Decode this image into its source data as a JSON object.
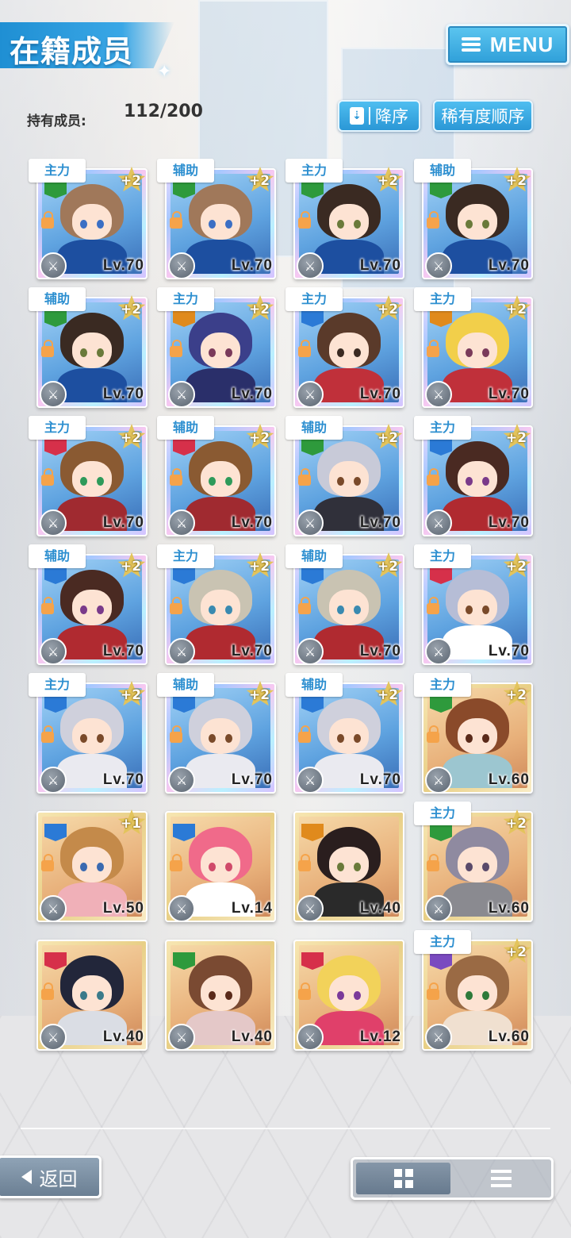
{
  "header": {
    "title": "在籍成员",
    "menu_label": "MENU"
  },
  "stats": {
    "owned_label": "持有成员:",
    "owned_value": "112/200"
  },
  "sort": {
    "order_label": "降序",
    "rarity_label": "稀有度顺序"
  },
  "cards": [
    {
      "role": "主力",
      "plus": "+2",
      "level": "Lv.70",
      "rarity": "rainbow",
      "attr_color": "#2e9a3c",
      "hair": "#a0785a",
      "eye": "#3b6fc4",
      "outfit": "#1d4fa0",
      "lock": true
    },
    {
      "role": "辅助",
      "plus": "+2",
      "level": "Lv.70",
      "rarity": "rainbow",
      "attr_color": "#2e9a3c",
      "hair": "#a0785a",
      "eye": "#3b6fc4",
      "outfit": "#1d4fa0",
      "lock": true
    },
    {
      "role": "主力",
      "plus": "+2",
      "level": "Lv.70",
      "rarity": "rainbow",
      "attr_color": "#2e9a3c",
      "hair": "#3a2a22",
      "eye": "#6a7a3a",
      "outfit": "#1d4fa0",
      "lock": true
    },
    {
      "role": "辅助",
      "plus": "+2",
      "level": "Lv.70",
      "rarity": "rainbow",
      "attr_color": "#2e9a3c",
      "hair": "#3a2a22",
      "eye": "#6a7a3a",
      "outfit": "#1d4fa0",
      "lock": true
    },
    {
      "role": "辅助",
      "plus": "+2",
      "level": "Lv.70",
      "rarity": "rainbow",
      "attr_color": "#2e9a3c",
      "hair": "#3a2a22",
      "eye": "#6a7a3a",
      "outfit": "#1d4fa0",
      "lock": true
    },
    {
      "role": "主力",
      "plus": "+2",
      "level": "Lv.70",
      "rarity": "rainbow",
      "attr_color": "#e08a1c",
      "hair": "#3b3f8a",
      "eye": "#7a3a5a",
      "outfit": "#2a2f6a",
      "lock": true
    },
    {
      "role": "主力",
      "plus": "+2",
      "level": "Lv.70",
      "rarity": "rainbow",
      "attr_color": "#2b7ad6",
      "hair": "#5a3a2a",
      "eye": "#3a2a22",
      "outfit": "#c0303a",
      "lock": true
    },
    {
      "role": "主力",
      "plus": "+2",
      "level": "Lv.70",
      "rarity": "rainbow",
      "attr_color": "#e08a1c",
      "hair": "#f2cf4a",
      "eye": "#7a3a5a",
      "outfit": "#c0303a",
      "lock": true
    },
    {
      "role": "主力",
      "plus": "+2",
      "level": "Lv.70",
      "rarity": "rainbow",
      "attr_color": "#d6304a",
      "hair": "#8a5a32",
      "eye": "#2e9a5a",
      "outfit": "#a02a30",
      "lock": true
    },
    {
      "role": "辅助",
      "plus": "+2",
      "level": "Lv.70",
      "rarity": "rainbow",
      "attr_color": "#d6304a",
      "hair": "#8a5a32",
      "eye": "#2e9a5a",
      "outfit": "#a02a30",
      "lock": true
    },
    {
      "role": "辅助",
      "plus": "+2",
      "level": "Lv.70",
      "rarity": "rainbow",
      "attr_color": "#2e9a3c",
      "hair": "#c8cad8",
      "eye": "#7a4a2a",
      "outfit": "#30303a",
      "lock": true
    },
    {
      "role": "主力",
      "plus": "+2",
      "level": "Lv.70",
      "rarity": "rainbow",
      "attr_color": "#2b7ad6",
      "hair": "#4a2a22",
      "eye": "#7a3a8a",
      "outfit": "#b02a30",
      "lock": true
    },
    {
      "role": "辅助",
      "plus": "+2",
      "level": "Lv.70",
      "rarity": "rainbow",
      "attr_color": "#2b7ad6",
      "hair": "#4a2a22",
      "eye": "#7a3a8a",
      "outfit": "#b02a30",
      "lock": true
    },
    {
      "role": "主力",
      "plus": "+2",
      "level": "Lv.70",
      "rarity": "rainbow",
      "attr_color": "#2b7ad6",
      "hair": "#c9c3b2",
      "eye": "#3a8ab0",
      "outfit": "#b02a30",
      "lock": true
    },
    {
      "role": "辅助",
      "plus": "+2",
      "level": "Lv.70",
      "rarity": "rainbow",
      "attr_color": "#2b7ad6",
      "hair": "#c9c3b2",
      "eye": "#3a8ab0",
      "outfit": "#b02a30",
      "lock": true
    },
    {
      "role": "主力",
      "plus": "+2",
      "level": "Lv.70",
      "rarity": "rainbow",
      "attr_color": "#d6304a",
      "hair": "#b6bdd6",
      "eye": "#7a4a2a",
      "outfit": "#ffffff",
      "lock": true
    },
    {
      "role": "主力",
      "plus": "+2",
      "level": "Lv.70",
      "rarity": "rainbow",
      "attr_color": "#2b7ad6",
      "hair": "#cfd0dc",
      "eye": "#7a4a2a",
      "outfit": "#eaeaf0",
      "lock": true
    },
    {
      "role": "辅助",
      "plus": "+2",
      "level": "Lv.70",
      "rarity": "rainbow",
      "attr_color": "#2b7ad6",
      "hair": "#cfd0dc",
      "eye": "#7a4a2a",
      "outfit": "#eaeaf0",
      "lock": true
    },
    {
      "role": "辅助",
      "plus": "+2",
      "level": "Lv.70",
      "rarity": "rainbow",
      "attr_color": "#2b7ad6",
      "hair": "#cfd0dc",
      "eye": "#7a4a2a",
      "outfit": "#eaeaf0",
      "lock": true
    },
    {
      "role": "主力",
      "plus": "+2",
      "level": "Lv.60",
      "rarity": "gold",
      "attr_color": "#2e9a3c",
      "hair": "#8a4a2a",
      "eye": "#5a2a1a",
      "outfit": "#9cc6d0",
      "lock": true
    },
    {
      "role": "",
      "plus": "+1",
      "level": "Lv.50",
      "rarity": "gold",
      "attr_color": "#2b7ad6",
      "hair": "#c48a4a",
      "eye": "#3a6ab0",
      "outfit": "#f0b0b8",
      "lock": true
    },
    {
      "role": "",
      "plus": "",
      "level": "Lv.14",
      "rarity": "gold",
      "attr_color": "#2b7ad6",
      "hair": "#f06a8a",
      "eye": "#d04a6a",
      "outfit": "#ffffff",
      "lock": true
    },
    {
      "role": "",
      "plus": "",
      "level": "Lv.40",
      "rarity": "gold",
      "attr_color": "#e08a1c",
      "hair": "#2a1e1e",
      "eye": "#6a7a3a",
      "outfit": "#2a2a2a",
      "lock": true
    },
    {
      "role": "主力",
      "plus": "+2",
      "level": "Lv.60",
      "rarity": "gold",
      "attr_color": "#2e9a3c",
      "hair": "#8f8aa0",
      "eye": "#5a4a6a",
      "outfit": "#8a8a90",
      "lock": true
    },
    {
      "role": "",
      "plus": "",
      "level": "Lv.40",
      "rarity": "gold",
      "attr_color": "#d6304a",
      "hair": "#22263a",
      "eye": "#3a7a8a",
      "outfit": "#dadde4",
      "lock": true
    },
    {
      "role": "",
      "plus": "",
      "level": "Lv.40",
      "rarity": "gold",
      "attr_color": "#2e9a3c",
      "hair": "#7a4a32",
      "eye": "#5a2a1a",
      "outfit": "#e4c8c8",
      "lock": false
    },
    {
      "role": "",
      "plus": "",
      "level": "Lv.12",
      "rarity": "gold",
      "attr_color": "#d6304a",
      "hair": "#f2d25a",
      "eye": "#7a3a9a",
      "outfit": "#e0406a",
      "lock": true
    },
    {
      "role": "主力",
      "plus": "+2",
      "level": "Lv.60",
      "rarity": "gold",
      "attr_color": "#7a4ac0",
      "hair": "#9a6a44",
      "eye": "#2e7a3a",
      "outfit": "#f0e0d0",
      "lock": true
    }
  ],
  "footer": {
    "back_label": "返回"
  }
}
